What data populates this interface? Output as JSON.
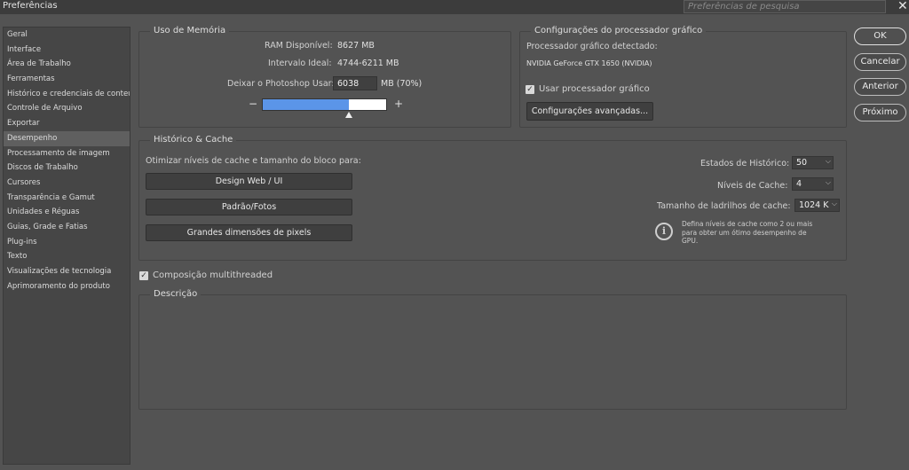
{
  "window": {
    "title": "Preferências",
    "search_placeholder": "Preferências de pesquisa",
    "close_glyph": "✕"
  },
  "sidebar": {
    "items": [
      {
        "label": "Geral"
      },
      {
        "label": "Interface"
      },
      {
        "label": "Área de Trabalho"
      },
      {
        "label": "Ferramentas"
      },
      {
        "label": "Histórico e credenciais de conteúdo"
      },
      {
        "label": "Controle de Arquivo"
      },
      {
        "label": "Exportar"
      },
      {
        "label": "Desempenho",
        "selected": true
      },
      {
        "label": "Processamento de imagem"
      },
      {
        "label": "Discos de Trabalho"
      },
      {
        "label": "Cursores"
      },
      {
        "label": "Transparência e Gamut"
      },
      {
        "label": "Unidades e Réguas"
      },
      {
        "label": "Guias, Grade e Fatias"
      },
      {
        "label": "Plug-ins"
      },
      {
        "label": "Texto"
      },
      {
        "label": "Visualizações de tecnologia"
      },
      {
        "label": "Aprimoramento do produto"
      }
    ]
  },
  "memory": {
    "legend": "Uso de Memória",
    "ram_label": "RAM Disponível:",
    "ram_value": "8627 MB",
    "ideal_label": "Intervalo Ideal:",
    "ideal_value": "4744-6211 MB",
    "use_label": "Deixar o Photoshop Usar:",
    "use_value": "6038",
    "use_unit": "MB (70%)",
    "slider_fraction": 0.7,
    "minus": "−",
    "plus": "+"
  },
  "gpu": {
    "legend": "Configurações do processador gráfico",
    "detected_label": "Processador gráfico detectado:",
    "detected_value": "NVIDIA GeForce GTX 1650 (NVIDIA)",
    "use_gpu_label": "Usar processador gráfico",
    "advanced_button": "Configurações avançadas..."
  },
  "history": {
    "legend": "Histórico & Cache",
    "optimize_label": "Otimizar níveis de cache e tamanho do bloco para:",
    "btn_web": "Design Web / UI",
    "btn_photo": "Padrão/Fotos",
    "btn_large": "Grandes dimensões de pixels",
    "states_label": "Estados de Histórico:",
    "states_value": "50",
    "cache_levels_label": "Níveis de Cache:",
    "cache_levels_value": "4",
    "tile_label": "Tamanho de ladrilhos de cache:",
    "tile_value": "1024 K",
    "info_text": "Defina níveis de cache como 2 ou mais para obter um ótimo desempenho de GPU."
  },
  "multithread": {
    "label": "Composição multithreaded"
  },
  "description": {
    "legend": "Descrição"
  },
  "buttons": {
    "ok": "OK",
    "cancel": "Cancelar",
    "prev": "Anterior",
    "next": "Próximo"
  }
}
